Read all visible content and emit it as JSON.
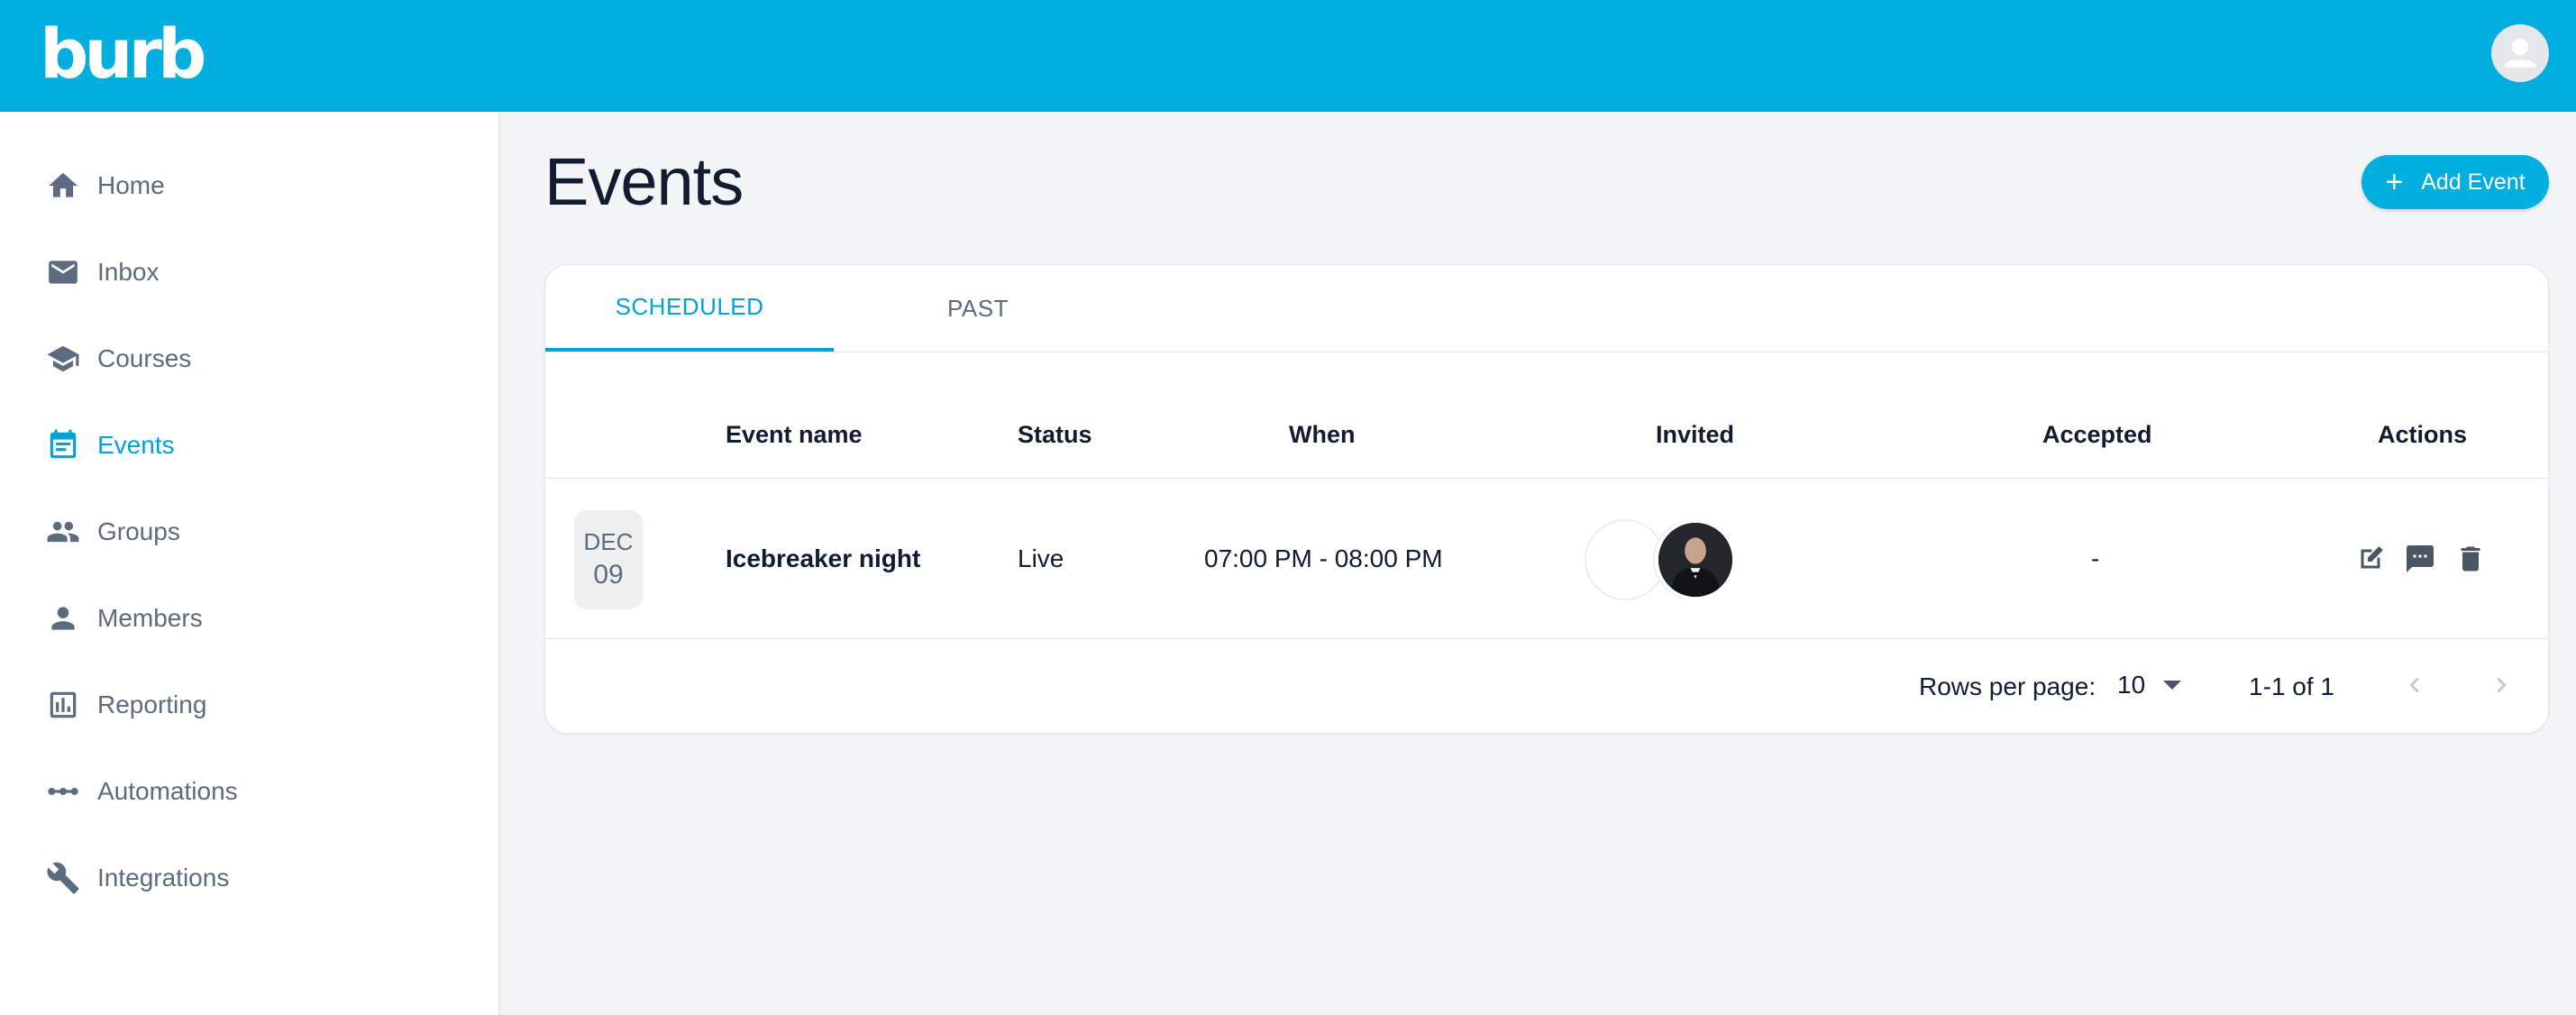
{
  "app": {
    "logo": "burb"
  },
  "sidebar": {
    "items": [
      {
        "label": "Home",
        "icon": "home-icon"
      },
      {
        "label": "Inbox",
        "icon": "mail-icon"
      },
      {
        "label": "Courses",
        "icon": "school-icon"
      },
      {
        "label": "Events",
        "icon": "calendar-icon",
        "active": true
      },
      {
        "label": "Groups",
        "icon": "people-icon"
      },
      {
        "label": "Members",
        "icon": "person-icon"
      },
      {
        "label": "Reporting",
        "icon": "chart-icon"
      },
      {
        "label": "Automations",
        "icon": "automation-icon"
      },
      {
        "label": "Integrations",
        "icon": "wrench-icon"
      }
    ]
  },
  "page": {
    "title": "Events",
    "add_button": "Add Event"
  },
  "tabs": [
    {
      "label": "SCHEDULED",
      "active": true
    },
    {
      "label": "PAST",
      "active": false
    }
  ],
  "table": {
    "columns": [
      "Event name",
      "Status",
      "When",
      "Invited",
      "Accepted",
      "Actions"
    ],
    "rows": [
      {
        "month": "DEC",
        "day": "09",
        "name": "Icebreaker night",
        "status": "Live",
        "when": "07:00 PM - 08:00 PM",
        "accepted": "-"
      }
    ]
  },
  "pagination": {
    "rows_per_page_label": "Rows per page:",
    "rows_per_page": "10",
    "range": "1-1 of 1"
  },
  "colors": {
    "brand": "#00afdf",
    "active": "#00a3d6",
    "text": "#111c33",
    "muted": "#5c6b80"
  }
}
